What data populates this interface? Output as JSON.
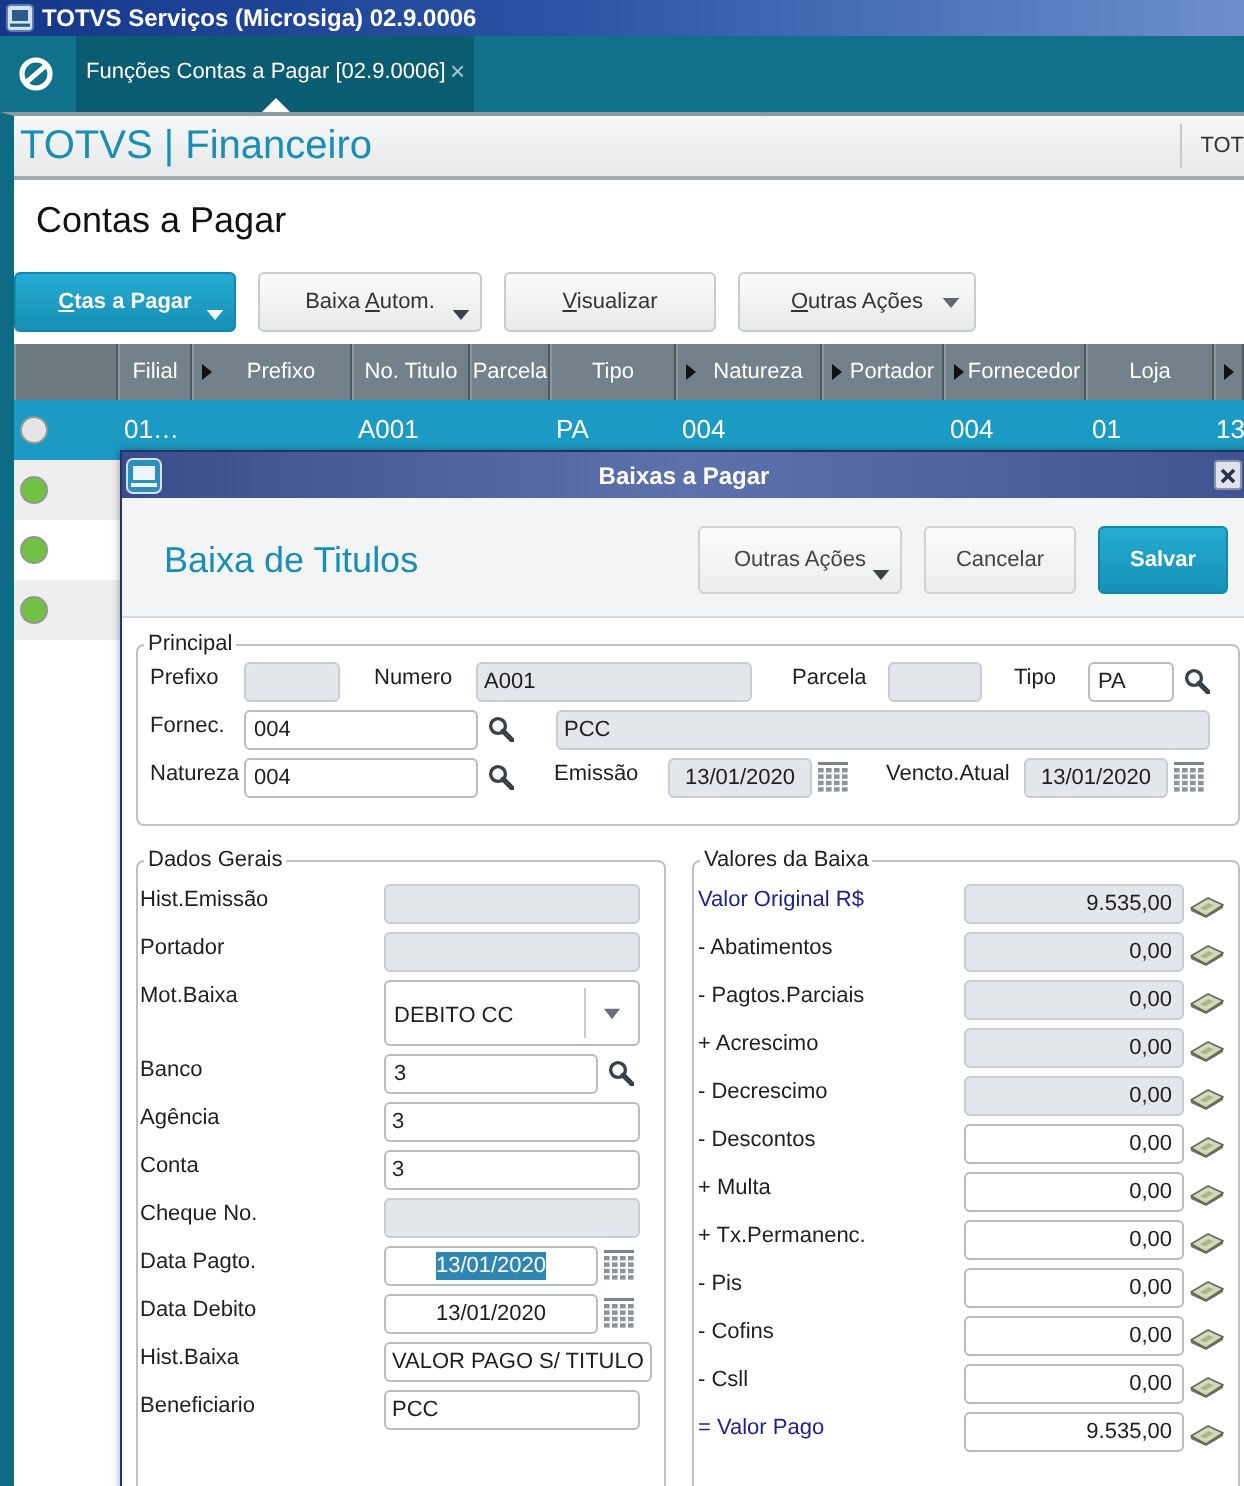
{
  "window": {
    "title": "TOTVS Serviços (Microsiga) 02.9.0006"
  },
  "tabs": [
    {
      "label": "Funções Contas a Pagar [02.9.0006]",
      "selected": true,
      "close": "×"
    }
  ],
  "app_header": {
    "title": "TOTVS | Financeiro",
    "right_label": "TOT"
  },
  "page": {
    "title": "Contas a Pagar",
    "actions": [
      {
        "kind": "primary",
        "label": {
          "key": "C",
          "after": "tas a Pagar"
        },
        "menu": true
      },
      {
        "kind": "secondary",
        "label": {
          "before": "Baixa ",
          "key": "A",
          "after": "utom."
        },
        "menu": true
      },
      {
        "kind": "secondary",
        "label": {
          "key": "V",
          "after": "isualizar"
        },
        "menu": false
      },
      {
        "kind": "dropdown",
        "label": {
          "key": "O",
          "after": "utras Ações"
        },
        "menu": true
      }
    ],
    "table": {
      "columns": [
        {
          "label": "Filial",
          "arrow": false
        },
        {
          "label": "Prefixo",
          "arrow": true
        },
        {
          "label": "No. Titulo",
          "arrow": false
        },
        {
          "label": "Parcela",
          "arrow": false
        },
        {
          "label": "Tipo",
          "arrow": false
        },
        {
          "label": "Natureza",
          "arrow": true
        },
        {
          "label": "Portador",
          "arrow": true
        },
        {
          "label": "Fornecedor",
          "arrow": true
        },
        {
          "label": "Loja",
          "arrow": false
        },
        {
          "arrow": true
        }
      ],
      "rows": [
        {
          "selected": true,
          "color": "#e4e4e4",
          "cells": [
            "01…",
            null,
            "A001",
            null,
            "PA",
            "004",
            null,
            "004",
            "01",
            "13"
          ]
        },
        {
          "selected": false,
          "color": "#72c142"
        },
        {
          "selected": false,
          "color": "#72c142"
        },
        {
          "selected": false,
          "color": "#72c142"
        }
      ]
    }
  },
  "dialog": {
    "title": "Baixas a Pagar",
    "heading": "Baixa de Titulos",
    "actions": [
      {
        "kind": "secondary",
        "label": "Outras Ações",
        "menu": true
      },
      {
        "kind": "secondary",
        "label": "Cancelar",
        "menu": false
      },
      {
        "kind": "primary",
        "label": "Salvar",
        "menu": false
      }
    ],
    "principal": {
      "legend": "Principal",
      "fields": [
        {
          "label": "Prefixo",
          "kind": "text",
          "disabled": true
        },
        {
          "label": "Numero",
          "kind": "text",
          "value": "A001",
          "disabled": true
        },
        {
          "label": "Parcela",
          "kind": "text",
          "disabled": true
        },
        {
          "label": "Tipo",
          "kind": "lookup",
          "value": "PA",
          "disabled": false
        },
        {
          "label": "Fornec.",
          "kind": "lookup",
          "value": "004",
          "disabled": false
        },
        {
          "kind": "text",
          "value": "PCC",
          "disabled": true
        },
        {
          "label": "Natureza",
          "kind": "lookup",
          "value": "004",
          "disabled": false
        },
        {
          "label": "Emissão",
          "kind": "date",
          "value": "13/01/2020",
          "disabled": true
        },
        {
          "label": "Vencto.Atual",
          "kind": "date",
          "value": "13/01/2020",
          "disabled": true
        }
      ]
    },
    "dados_gerais": {
      "legend": "Dados Gerais",
      "fields": [
        {
          "label": "Hist.Emissão",
          "kind": "text",
          "disabled": true
        },
        {
          "label": "Portador",
          "kind": "text",
          "disabled": true
        },
        {
          "label": "Mot.Baixa",
          "kind": "select",
          "value": "DEBITO CC",
          "disabled": false
        },
        {
          "label": "Banco",
          "kind": "lookup",
          "value": "3",
          "disabled": false
        },
        {
          "label": "Agência",
          "kind": "text",
          "value": "3",
          "disabled": false
        },
        {
          "label": "Conta",
          "kind": "text",
          "value": "3",
          "disabled": false
        },
        {
          "label": "Cheque No.",
          "kind": "text",
          "disabled": true
        },
        {
          "label": "Data Pagto.",
          "kind": "date",
          "value": "13/01/2020",
          "disabled": false,
          "text_selected": true
        },
        {
          "label": "Data Debito",
          "kind": "date",
          "value": "13/01/2020",
          "disabled": false,
          "text_selected": false
        },
        {
          "label": "Hist.Baixa",
          "kind": "text",
          "value": "VALOR PAGO S/ TITULO",
          "disabled": false
        },
        {
          "label": "Beneficiario",
          "kind": "text",
          "value": "PCC",
          "disabled": false
        }
      ]
    },
    "valores": {
      "legend": "Valores da Baixa",
      "fields": [
        {
          "label": "Valor Original R$",
          "kind": "money",
          "value": "9.535,00",
          "disabled": true,
          "emphasized": true
        },
        {
          "label": "- Abatimentos",
          "kind": "money",
          "value": "0,00",
          "disabled": true,
          "emphasized": false
        },
        {
          "label": "- Pagtos.Parciais",
          "kind": "money",
          "value": "0,00",
          "disabled": true,
          "emphasized": false
        },
        {
          "label": "+ Acrescimo",
          "kind": "money",
          "value": "0,00",
          "disabled": true,
          "emphasized": false
        },
        {
          "label": "- Decrescimo",
          "kind": "money",
          "value": "0,00",
          "disabled": true,
          "emphasized": false
        },
        {
          "label": "- Descontos",
          "kind": "money",
          "value": "0,00",
          "disabled": false,
          "emphasized": false
        },
        {
          "label": "+ Multa",
          "kind": "money",
          "value": "0,00",
          "disabled": false,
          "emphasized": false
        },
        {
          "label": "+ Tx.Permanenc.",
          "kind": "money",
          "value": "0,00",
          "disabled": false,
          "emphasized": false
        },
        {
          "label": "- Pis",
          "kind": "money",
          "value": "0,00",
          "disabled": false,
          "emphasized": false
        },
        {
          "label": "- Cofins",
          "kind": "money",
          "value": "0,00",
          "disabled": false,
          "emphasized": false
        },
        {
          "label": "- Csll",
          "kind": "money",
          "value": "0,00",
          "disabled": false,
          "emphasized": false
        },
        {
          "label": "= Valor Pago",
          "kind": "money",
          "value": "9.535,00",
          "disabled": false,
          "emphasized": true
        }
      ]
    }
  }
}
